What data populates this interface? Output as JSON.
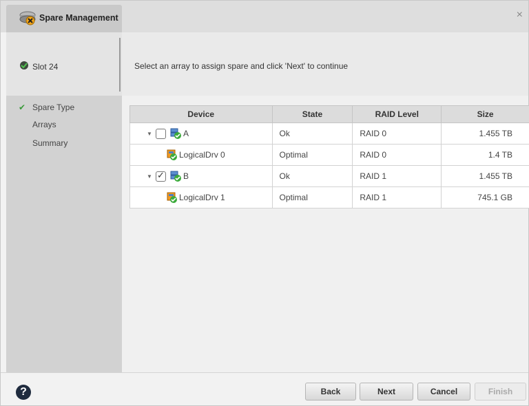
{
  "window": {
    "title": "Spare Management",
    "close_icon": "×"
  },
  "sidebar": {
    "slot_label": "Slot 24",
    "steps": [
      {
        "label": "Spare Type",
        "state": "completed"
      },
      {
        "label": "Arrays",
        "state": "current"
      },
      {
        "label": "Summary",
        "state": "pending"
      }
    ]
  },
  "main": {
    "instructions": "Select an array to assign spare and click 'Next' to continue",
    "table": {
      "columns": [
        "Device",
        "State",
        "RAID Level",
        "Size"
      ],
      "rows": [
        {
          "type": "array",
          "device": "A",
          "state": "Ok",
          "raid": "RAID 0",
          "size": "1.455 TB",
          "checked": false
        },
        {
          "type": "logical",
          "device": "LogicalDrv 0",
          "state": "Optimal",
          "raid": "RAID 0",
          "size": "1.4 TB"
        },
        {
          "type": "array",
          "device": "B",
          "state": "Ok",
          "raid": "RAID 1",
          "size": "1.455 TB",
          "checked": true
        },
        {
          "type": "logical",
          "device": "LogicalDrv 1",
          "state": "Optimal",
          "raid": "RAID 1",
          "size": "745.1 GB"
        }
      ]
    }
  },
  "footer": {
    "help_label": "?",
    "back_label": "Back",
    "next_label": "Next",
    "cancel_label": "Cancel",
    "finish_label": "Finish"
  },
  "icons": {
    "title": "spare-drive-icon",
    "slot": "drive-slot-icon",
    "array": "array-icon",
    "logical_drive": "logical-drive-icon",
    "step_done": "checkmark-icon",
    "help": "help-icon"
  },
  "colors": {
    "check_green": "#3a9a3a",
    "help_dark": "#1f2b3e"
  }
}
